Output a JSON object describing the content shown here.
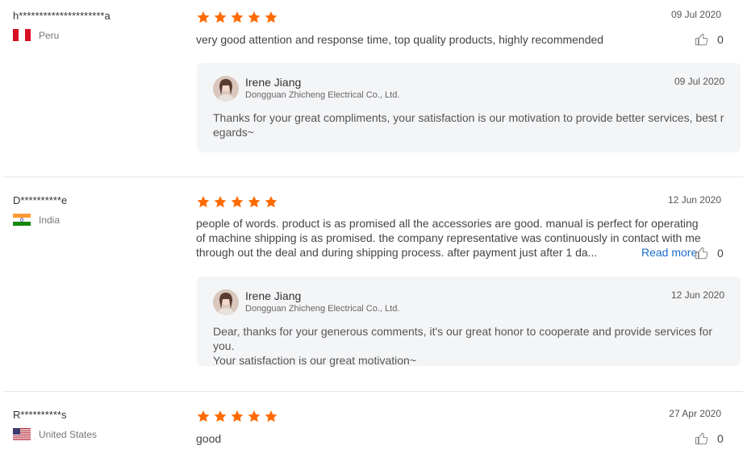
{
  "reviews": [
    {
      "buyer": "h*********************a",
      "country": "Peru",
      "flag": "peru",
      "rating": 5,
      "date": "09 Jul 2020",
      "text_lines": [
        "very good attention and response time, top quality products, highly recommended"
      ],
      "likes": "0",
      "reply": {
        "name": "Irene Jiang",
        "company": "Dongguan Zhicheng Electrical Co., Ltd.",
        "date": "09 Jul 2020",
        "text_lines": [
          "Thanks for  your great compliments,  your satisfaction is our motivation to provide better services, best r",
          "egards~"
        ]
      }
    },
    {
      "buyer": "D**********e",
      "country": "India",
      "flag": "india",
      "rating": 5,
      "date": "12 Jun 2020",
      "text_lines": [
        "people of words. product is as promised all the accessories are good. manual is perfect for operating",
        "of machine shipping is as promised. the company representative was continuously in contact with me",
        "through out the deal and during shipping process. after payment just after 1 da..."
      ],
      "read_more": "Read more",
      "likes": "0",
      "reply": {
        "name": "Irene Jiang",
        "company": "Dongguan Zhicheng Electrical Co., Ltd.",
        "date": "12 Jun 2020",
        "text_lines": [
          "Dear, thanks for your generous comments, it's our great honor to cooperate and provide services for you.",
          "Your satisfaction is our great motivation~"
        ]
      }
    },
    {
      "buyer": "R**********s",
      "country": "United States",
      "flag": "usa",
      "rating": 5,
      "date": "27 Apr 2020",
      "text_lines": [
        "good"
      ],
      "likes": "0"
    }
  ],
  "colors": {
    "star": "#ff6a00",
    "link": "#1a6fc9",
    "reply_bg": "#f4f5f7"
  },
  "icons": {
    "star": "star-icon",
    "like": "thumbs-up-icon"
  }
}
